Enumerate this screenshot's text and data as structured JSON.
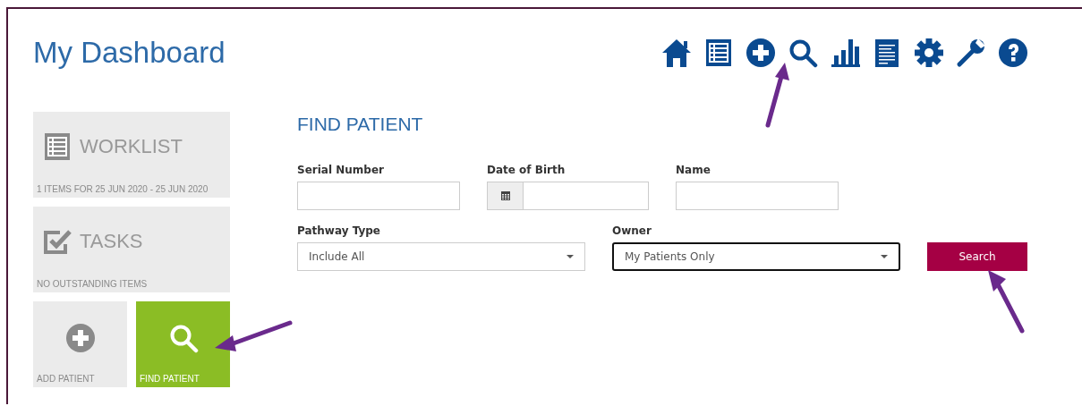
{
  "page_title": "My Dashboard",
  "tiles": [
    {
      "kind": "wide",
      "title": "WORKLIST",
      "caption": "1 ITEMS FOR 25 JUN 2020 - 25 JUN 2020",
      "selected": false
    },
    {
      "kind": "wide",
      "title": "TASKS",
      "caption": "NO OUTSTANDING ITEMS",
      "selected": false
    },
    {
      "kind": "small",
      "caption": "ADD PATIENT",
      "selected": false
    },
    {
      "kind": "small",
      "caption": "FIND PATIENT",
      "selected": true
    }
  ],
  "form": {
    "heading": "FIND PATIENT",
    "fields": [
      {
        "kind": "text",
        "label": "Serial Number"
      },
      {
        "kind": "date",
        "label": "Date of Birth"
      },
      {
        "kind": "text",
        "label": "Name"
      }
    ],
    "selects": [
      {
        "label": "Pathway Type",
        "value": "Include All",
        "focused": false
      },
      {
        "label": "Owner",
        "value": "My Patients Only",
        "focused": true
      }
    ],
    "button": "Search"
  },
  "annotations": [
    {
      "kind": "arrow"
    },
    {
      "kind": "arrow"
    },
    {
      "kind": "arrow"
    }
  ]
}
